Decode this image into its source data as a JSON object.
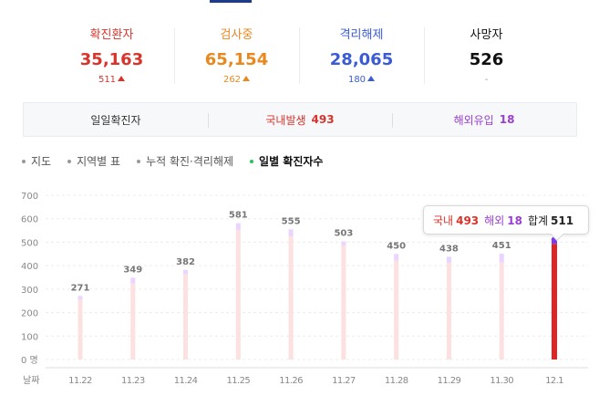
{
  "stats": [
    {
      "label": "확진환자",
      "value": "35,163",
      "change": "511",
      "color": "#d9342b",
      "arrow": true
    },
    {
      "label": "검사중",
      "value": "65,154",
      "change": "262",
      "color": "#e8881f",
      "arrow": true
    },
    {
      "label": "격리해제",
      "value": "28,065",
      "change": "180",
      "color": "#3b5bd6",
      "arrow": true
    },
    {
      "label": "사망자",
      "value": "526",
      "change": "-",
      "color": "#111111",
      "arrow": false
    }
  ],
  "tabs": [
    {
      "label": "일일확진자",
      "count": "",
      "color": "#333333"
    },
    {
      "label": "국내발생",
      "count": "493",
      "color": "#d9342b"
    },
    {
      "label": "해외유입",
      "count": "18",
      "color": "#9b3fd0"
    }
  ],
  "subtabs": [
    {
      "label": "지도",
      "active": false
    },
    {
      "label": "지역별 표",
      "active": false
    },
    {
      "label": "누적 확진·격리해제",
      "active": false
    },
    {
      "label": "일별 확진자수",
      "active": true
    }
  ],
  "chart_data": {
    "type": "bar",
    "categories": [
      "11.22",
      "11.23",
      "11.24",
      "11.25",
      "11.26",
      "11.27",
      "11.28",
      "11.29",
      "11.30",
      "12.1"
    ],
    "series": [
      {
        "name": "국내",
        "values": [
          255,
          324,
          363,
          553,
          525,
          486,
          422,
          413,
          414,
          493
        ],
        "color": "#fde0e0"
      },
      {
        "name": "해외",
        "values": [
          16,
          25,
          19,
          28,
          30,
          17,
          28,
          25,
          37,
          18
        ],
        "color": "#e9d5ff"
      }
    ],
    "totals": [
      "271",
      "349",
      "382",
      "581",
      "555",
      "503",
      "450",
      "438",
      "451",
      ""
    ],
    "ylim": [
      0,
      700
    ],
    "yticks": [
      "700",
      "600",
      "500",
      "400",
      "300",
      "200",
      "100",
      "0 명"
    ],
    "xlabel": "날짜",
    "highlight_index": 9,
    "highlight_colors": {
      "domestic": "#e02424",
      "overseas": "#7c3aed"
    },
    "tooltip": {
      "domestic_label": "국내",
      "domestic_value": "493",
      "overseas_label": "해외",
      "overseas_value": "18",
      "total_label": "합계",
      "total_value": "511"
    }
  }
}
